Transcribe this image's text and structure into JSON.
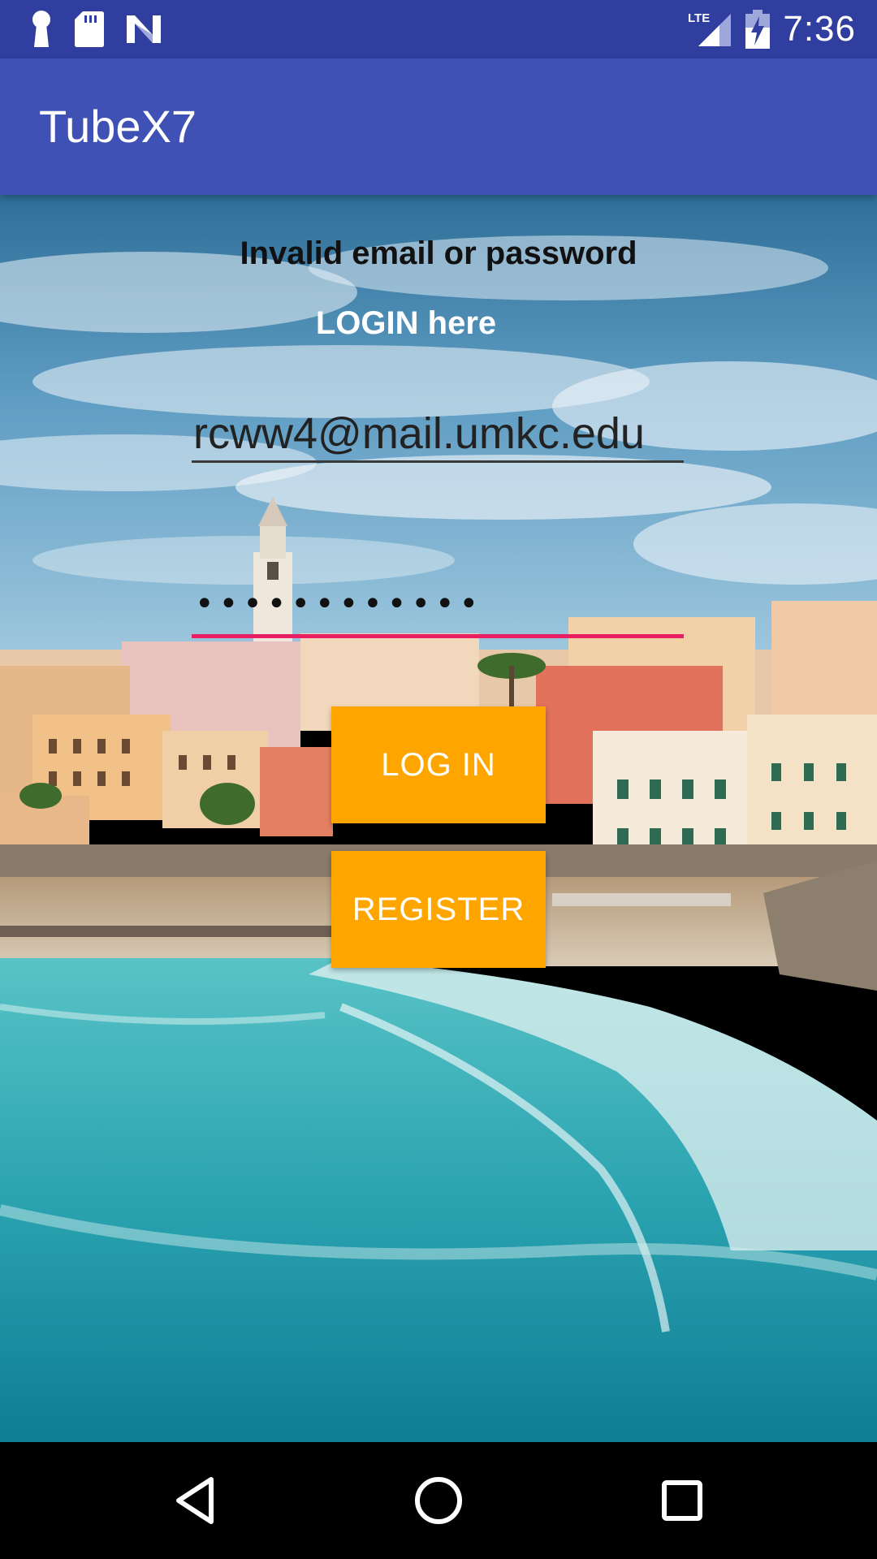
{
  "status_bar": {
    "time": "7:36",
    "left_icons": [
      "keyhole-icon",
      "sd-card-icon",
      "n-logo-icon"
    ],
    "right_icons": [
      "lte-signal-icon",
      "battery-charging-icon"
    ],
    "network_label": "LTE",
    "background": "#303f9f"
  },
  "app_bar": {
    "title": "TubeX7",
    "background": "#3f51b5"
  },
  "login": {
    "error_message": "Invalid email or password",
    "heading": "LOGIN here",
    "email_value": "rcww4@mail.umkc.edu",
    "password_value": "••••••••••••",
    "login_button": "LOG IN",
    "register_button": "REGISTER",
    "button_color": "#ffa500",
    "focus_underline_color": "#e91e63"
  },
  "nav_bar": {
    "icons": [
      "back-icon",
      "home-icon",
      "recents-icon"
    ]
  }
}
